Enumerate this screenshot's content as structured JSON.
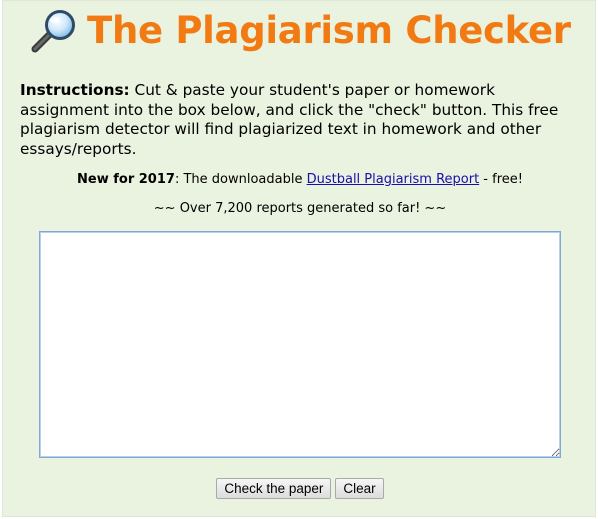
{
  "header": {
    "title": "The Plagiarism Checker",
    "icon": "magnifier-icon"
  },
  "instructions": {
    "label": "Instructions:",
    "text": " Cut & paste your student's paper or homework assignment into the box below, and click the \"check\" button. This free plagiarism detector will find plagiarized text in homework and other essays/reports."
  },
  "announcement": {
    "prefix": "New for 2017",
    "middle": ": The downloadable ",
    "link_text": "Dustball Plagiarism Report",
    "suffix": " - free!"
  },
  "counter_text": "~~ Over 7,200 reports generated so far! ~~",
  "textarea": {
    "value": "",
    "placeholder": ""
  },
  "buttons": {
    "check_label": "Check the paper",
    "clear_label": "Clear"
  },
  "colors": {
    "title": "#f27a12",
    "background": "#eaf2e0",
    "link": "#1a0dab"
  }
}
